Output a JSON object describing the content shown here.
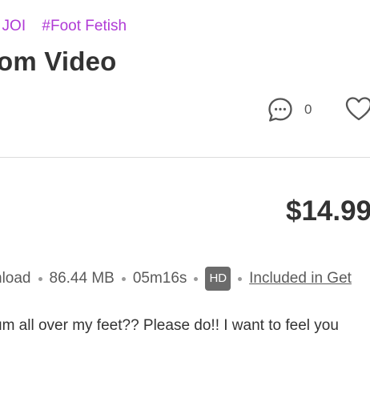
{
  "tags": [
    "t JOI",
    "#Foot Fetish"
  ],
  "title": "om Video",
  "actions": {
    "comment_icon": "comment-bubble-icon",
    "comment_count": "0",
    "like_icon": "heart-icon"
  },
  "price": "$14.99",
  "meta": {
    "download_label": "nload",
    "file_size": "86.44 MB",
    "duration": "05m16s",
    "quality_badge": "HD",
    "included_link": "Included in Get"
  },
  "description": "um all over my feet?? Please do!! I want to feel you",
  "colors": {
    "tag": "#b03bd6",
    "text": "#333333",
    "badge_bg": "#6b6b6b"
  }
}
